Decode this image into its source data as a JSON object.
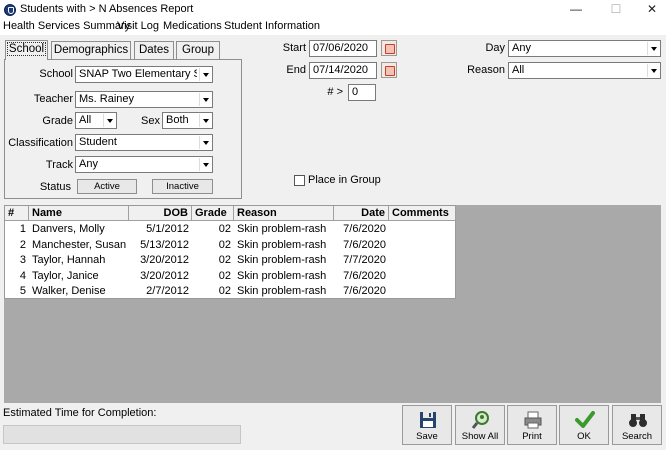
{
  "window": {
    "title": "Students with > N Absences Report",
    "controls": {
      "minimize": "—",
      "maximize": "☐",
      "close": "✕"
    }
  },
  "menu": [
    "Health Services Summary",
    "Visit Log",
    "Medications",
    "Student Information"
  ],
  "tabs": [
    "School",
    "Demographics",
    "Dates",
    "Group"
  ],
  "filters": {
    "school_label": "School",
    "school_value": "SNAP Two Elementary Scho",
    "teacher_label": "Teacher",
    "teacher_value": "Ms. Rainey",
    "grade_label": "Grade",
    "grade_value": "All",
    "sex_label": "Sex",
    "sex_value": "Both",
    "classification_label": "Classification",
    "classification_value": "Student",
    "track_label": "Track",
    "track_value": "Any",
    "status_label": "Status",
    "status_active": "Active",
    "status_inactive": "Inactive"
  },
  "dates": {
    "start_label": "Start",
    "start_value": "07/06/2020",
    "end_label": "End",
    "end_value": "07/14/2020",
    "n_label": "# >",
    "n_value": "0"
  },
  "right_filters": {
    "day_label": "Day",
    "day_value": "Any",
    "reason_label": "Reason",
    "reason_value": "All"
  },
  "place_in_group": "Place in Group",
  "grid": {
    "headers": [
      "#",
      "Name",
      "DOB",
      "Grade",
      "Reason",
      "Date",
      "Comments"
    ],
    "rows": [
      [
        "1",
        "Danvers, Molly",
        "5/1/2012",
        "02",
        "Skin problem-rash",
        "7/6/2020",
        ""
      ],
      [
        "2",
        "Manchester, Susan",
        "5/13/2012",
        "02",
        "Skin problem-rash",
        "7/6/2020",
        ""
      ],
      [
        "3",
        "Taylor, Hannah",
        "3/20/2012",
        "02",
        "Skin problem-rash",
        "7/7/2020",
        ""
      ],
      [
        "4",
        "Taylor, Janice",
        "3/20/2012",
        "02",
        "Skin problem-rash",
        "7/6/2020",
        ""
      ],
      [
        "5",
        "Walker, Denise",
        "2/7/2012",
        "02",
        "Skin problem-rash",
        "7/6/2020",
        ""
      ]
    ]
  },
  "footer": {
    "estimated_label": "Estimated Time for Completion:",
    "buttons": [
      "Save",
      "Show All",
      "Print",
      "OK",
      "Search"
    ],
    "icons": [
      "floppy-disk-icon",
      "magnifier-people-icon",
      "printer-icon",
      "checkmark-icon",
      "binoculars-icon"
    ],
    "ok_color": "#3a9a2c"
  }
}
